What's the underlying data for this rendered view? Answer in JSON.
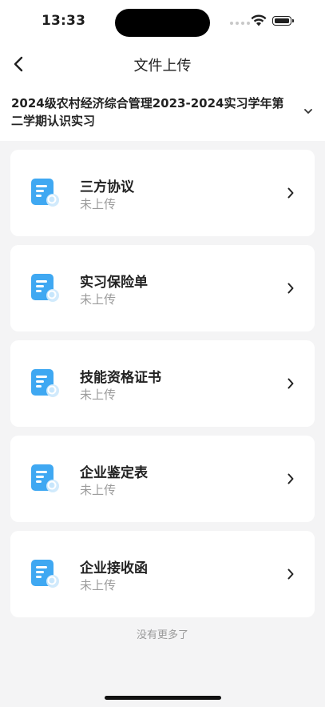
{
  "status_bar": {
    "time": "13:33"
  },
  "nav": {
    "title": "文件上传",
    "back_icon": "chevron-left-icon"
  },
  "program": {
    "title": "2024级农村经济综合管理2023-2024实习学年第二学期认识实习",
    "expand_icon": "chevron-down-icon"
  },
  "documents": [
    {
      "name": "三方协议",
      "status": "未上传",
      "icon": "document-icon"
    },
    {
      "name": "实习保险单",
      "status": "未上传",
      "icon": "document-icon"
    },
    {
      "name": "技能资格证书",
      "status": "未上传",
      "icon": "document-icon"
    },
    {
      "name": "企业鉴定表",
      "status": "未上传",
      "icon": "document-icon"
    },
    {
      "name": "企业接收函",
      "status": "未上传",
      "icon": "document-icon"
    }
  ],
  "footer": {
    "end_text": "没有更多了"
  },
  "colors": {
    "page_bg": "#f4f4f5",
    "card_bg": "#ffffff",
    "icon_blue": "#3fa8f2",
    "muted_text": "#9c9c9c"
  }
}
